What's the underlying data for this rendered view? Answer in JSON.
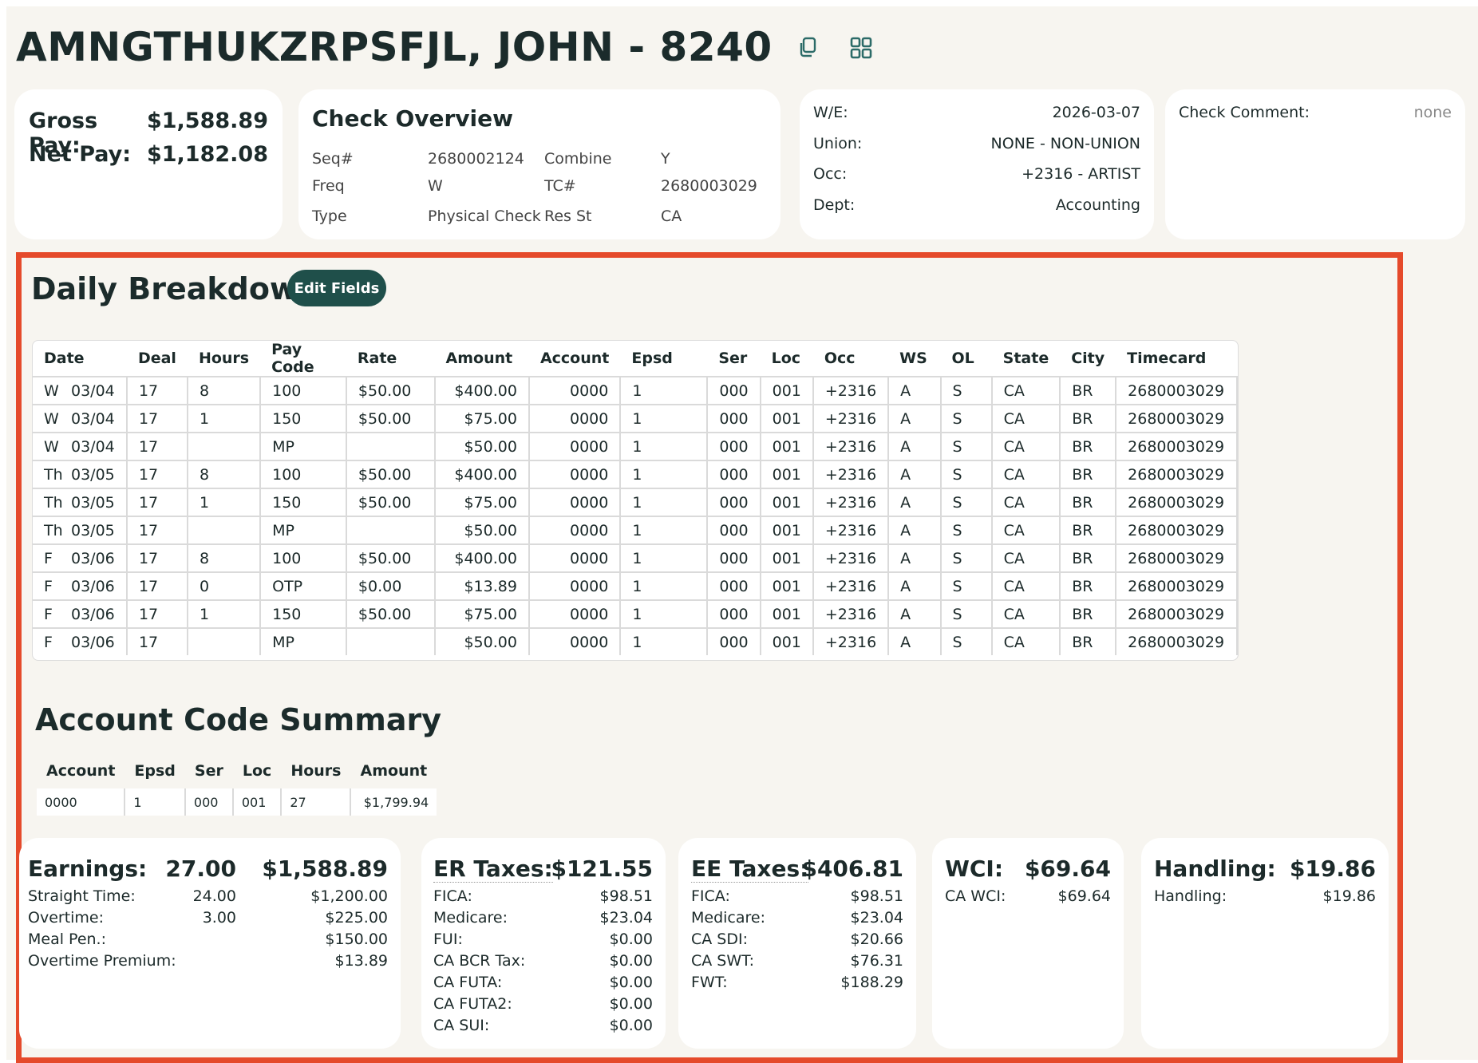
{
  "header": {
    "title": "AMNGTHUKZRPSFJL, JOHN - 8240",
    "copy_icon": "copy-icon",
    "qr_icon": "qr-code-icon"
  },
  "pay": {
    "gross_label": "Gross Pay:",
    "gross_value": "$1,588.89",
    "net_label": "Net Pay:",
    "net_value": "$1,182.08"
  },
  "check_overview": {
    "title": "Check Overview",
    "fields": [
      {
        "label": "Seq#",
        "value": "2680002124"
      },
      {
        "label": "Combine",
        "value": "Y"
      },
      {
        "label": "Freq",
        "value": "W"
      },
      {
        "label": "TC#",
        "value": "2680003029"
      },
      {
        "label": "Type",
        "value": "Physical Check"
      },
      {
        "label": "Res St",
        "value": "CA"
      }
    ]
  },
  "job_info": [
    {
      "label": "W/E:",
      "value": "2026-03-07"
    },
    {
      "label": "Union:",
      "value": "NONE - NON-UNION"
    },
    {
      "label": "Occ:",
      "value": "+2316 - ARTIST"
    },
    {
      "label": "Dept:",
      "value": "Accounting"
    }
  ],
  "comment": {
    "label": "Check Comment:",
    "value": "none"
  },
  "daily": {
    "title": "Daily Breakdown",
    "edit_label": "Edit Fields",
    "columns": [
      "Date",
      "Deal",
      "Hours",
      "Pay Code",
      "Rate",
      "Amount",
      "Account",
      "Epsd",
      "Ser",
      "Loc",
      "Occ",
      "WS",
      "OL",
      "State",
      "City",
      "Timecard"
    ],
    "rows": [
      [
        "W",
        "03/04",
        "17",
        "8",
        "100",
        "$50.00",
        "$400.00",
        "0000",
        "1",
        "000",
        "001",
        "+2316",
        "A",
        "S",
        "CA",
        "BR",
        "2680003029"
      ],
      [
        "W",
        "03/04",
        "17",
        "1",
        "150",
        "$50.00",
        "$75.00",
        "0000",
        "1",
        "000",
        "001",
        "+2316",
        "A",
        "S",
        "CA",
        "BR",
        "2680003029"
      ],
      [
        "W",
        "03/04",
        "17",
        "",
        "MP",
        "",
        "$50.00",
        "0000",
        "1",
        "000",
        "001",
        "+2316",
        "A",
        "S",
        "CA",
        "BR",
        "2680003029"
      ],
      [
        "Th",
        "03/05",
        "17",
        "8",
        "100",
        "$50.00",
        "$400.00",
        "0000",
        "1",
        "000",
        "001",
        "+2316",
        "A",
        "S",
        "CA",
        "BR",
        "2680003029"
      ],
      [
        "Th",
        "03/05",
        "17",
        "1",
        "150",
        "$50.00",
        "$75.00",
        "0000",
        "1",
        "000",
        "001",
        "+2316",
        "A",
        "S",
        "CA",
        "BR",
        "2680003029"
      ],
      [
        "Th",
        "03/05",
        "17",
        "",
        "MP",
        "",
        "$50.00",
        "0000",
        "1",
        "000",
        "001",
        "+2316",
        "A",
        "S",
        "CA",
        "BR",
        "2680003029"
      ],
      [
        "F",
        "03/06",
        "17",
        "8",
        "100",
        "$50.00",
        "$400.00",
        "0000",
        "1",
        "000",
        "001",
        "+2316",
        "A",
        "S",
        "CA",
        "BR",
        "2680003029"
      ],
      [
        "F",
        "03/06",
        "17",
        "0",
        "OTP",
        "$0.00",
        "$13.89",
        "0000",
        "1",
        "000",
        "001",
        "+2316",
        "A",
        "S",
        "CA",
        "BR",
        "2680003029"
      ],
      [
        "F",
        "03/06",
        "17",
        "1",
        "150",
        "$50.00",
        "$75.00",
        "0000",
        "1",
        "000",
        "001",
        "+2316",
        "A",
        "S",
        "CA",
        "BR",
        "2680003029"
      ],
      [
        "F",
        "03/06",
        "17",
        "",
        "MP",
        "",
        "$50.00",
        "0000",
        "1",
        "000",
        "001",
        "+2316",
        "A",
        "S",
        "CA",
        "BR",
        "2680003029"
      ]
    ]
  },
  "account_summary": {
    "title": "Account Code Summary",
    "columns": [
      "Account",
      "Epsd",
      "Ser",
      "Loc",
      "Hours",
      "Amount"
    ],
    "rows": [
      [
        "0000",
        "1",
        "000",
        "001",
        "27",
        "$1,799.94"
      ]
    ]
  },
  "earnings": {
    "label": "Earnings:",
    "hours": "27.00",
    "amount": "$1,588.89",
    "lines": [
      {
        "label": "Straight Time:",
        "hours": "24.00",
        "amount": "$1,200.00"
      },
      {
        "label": "Overtime:",
        "hours": "3.00",
        "amount": "$225.00"
      },
      {
        "label": "Meal Pen.:",
        "hours": "",
        "amount": "$150.00"
      },
      {
        "label": "Overtime Premium:",
        "hours": "",
        "amount": "$13.89"
      }
    ]
  },
  "er_taxes": {
    "label": "ER Taxes:",
    "amount": "$121.55",
    "lines": [
      {
        "label": "FICA:",
        "amount": "$98.51"
      },
      {
        "label": "Medicare:",
        "amount": "$23.04"
      },
      {
        "label": "FUI:",
        "amount": "$0.00"
      },
      {
        "label": "CA BCR Tax:",
        "amount": "$0.00"
      },
      {
        "label": "CA FUTA:",
        "amount": "$0.00"
      },
      {
        "label": "CA FUTA2:",
        "amount": "$0.00"
      },
      {
        "label": "CA SUI:",
        "amount": "$0.00"
      }
    ]
  },
  "ee_taxes": {
    "label": "EE Taxes:",
    "amount": "$406.81",
    "lines": [
      {
        "label": "FICA:",
        "amount": "$98.51"
      },
      {
        "label": "Medicare:",
        "amount": "$23.04"
      },
      {
        "label": "CA SDI:",
        "amount": "$20.66"
      },
      {
        "label": "CA SWT:",
        "amount": "$76.31"
      },
      {
        "label": "FWT:",
        "amount": "$188.29"
      }
    ]
  },
  "wci": {
    "label": "WCI:",
    "amount": "$69.64",
    "lines": [
      {
        "label": "CA WCI:",
        "amount": "$69.64"
      }
    ]
  },
  "handling": {
    "label": "Handling:",
    "amount": "$19.86",
    "lines": [
      {
        "label": "Handling:",
        "amount": "$19.86"
      }
    ]
  },
  "colors": {
    "accent": "#1f4f4a",
    "highlight": "#e54a2b",
    "background": "#f7f5f0"
  }
}
